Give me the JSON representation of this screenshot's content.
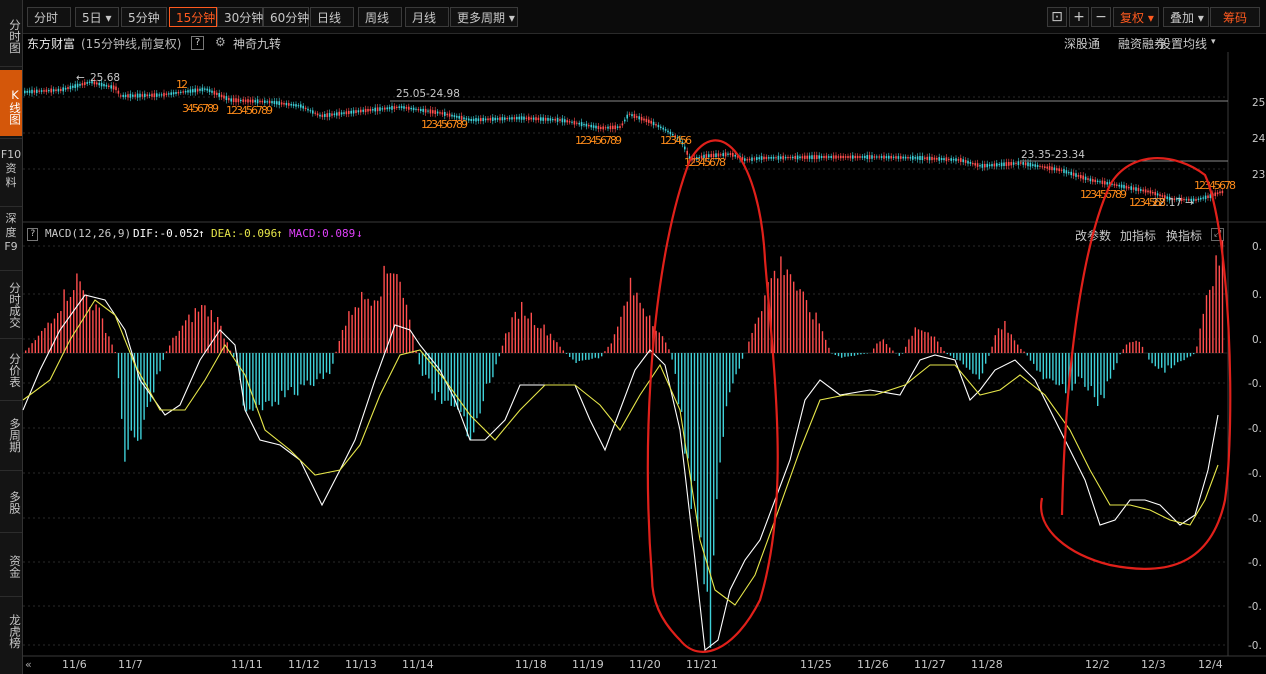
{
  "sidebar": {
    "items": [
      {
        "label": "分时图",
        "active": false
      },
      {
        "label": "K线图",
        "active": true
      },
      {
        "label": "F10资料",
        "active": false
      },
      {
        "label": "深度F9",
        "active": false
      },
      {
        "label": "分时成交",
        "active": false
      },
      {
        "label": "分价表",
        "active": false
      },
      {
        "label": "多周期",
        "active": false
      },
      {
        "label": "多股",
        "active": false
      },
      {
        "label": "资金",
        "active": false
      },
      {
        "label": "龙虎榜",
        "active": false
      }
    ]
  },
  "toolbar": {
    "buttons": [
      "分时",
      "5日",
      "5分钟",
      "15分钟",
      "30分钟",
      "60分钟",
      "日线",
      "周线",
      "月线",
      "更多周期"
    ],
    "active_index": 3,
    "right": {
      "fq": "复权",
      "overlay": "叠加",
      "chips": "筹码"
    }
  },
  "info": {
    "stock": "东方财富",
    "desc": "(15分钟线,前复权)",
    "help": "?",
    "plugin": "神奇九转",
    "right_links": [
      "深股通",
      "融资融券",
      "设置均线"
    ]
  },
  "price_chart": {
    "annotations": {
      "high": "25.68",
      "mid_range": "25.05-24.98",
      "right_range": "23.35-23.34",
      "low": "22.17"
    },
    "yticks": [
      "25.",
      "24.",
      "23."
    ],
    "nine_turn": [
      "12",
      "3456789",
      "123456789",
      "123456789",
      "123456789",
      "123456",
      "12345678",
      "123456789",
      "1234568",
      "12345678"
    ]
  },
  "macd": {
    "help": "?",
    "title": "MACD(12,26,9)",
    "dif": "DIF:-0.052",
    "dea": "DEA:-0.096",
    "macd": "MACD:0.089",
    "right_links": [
      "改参数",
      "加指标",
      "换指标"
    ],
    "yticks": [
      "0.",
      "0.",
      "0.",
      "-0.",
      "-0.",
      "-0.",
      "-0.",
      "-0.",
      "-0.",
      "-0."
    ]
  },
  "xaxis": {
    "labels": [
      "11/6",
      "11/7",
      "11/11",
      "11/12",
      "11/13",
      "11/14",
      "11/18",
      "11/19",
      "11/20",
      "11/21",
      "11/25",
      "11/26",
      "11/27",
      "11/28",
      "12/2",
      "12/3",
      "12/4"
    ]
  },
  "colors": {
    "accent": "#ff5a1f",
    "up": "#ff4e4e",
    "down": "#3fd0d8",
    "dif": "#ffffff",
    "dea": "#e6e64a",
    "macd": "#e040fb",
    "annotation": "#e0201a"
  }
}
